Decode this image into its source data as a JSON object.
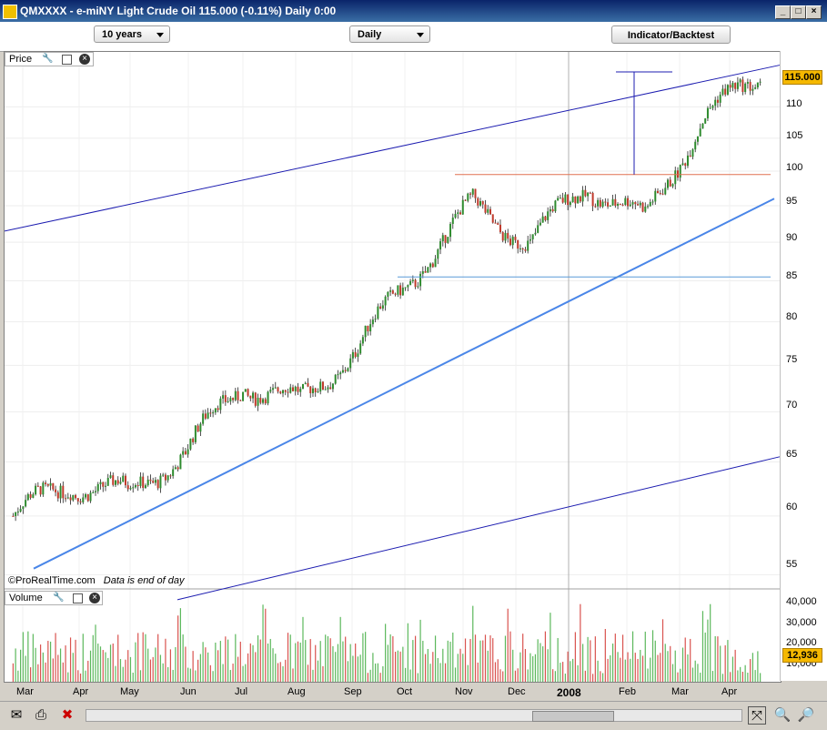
{
  "window": {
    "title": "QMXXXX - e-miNY Light Crude Oil   115.000 (-0.11%)   Daily  0:00",
    "minimize": "_",
    "maximize": "□",
    "close": "×"
  },
  "toolbar": {
    "period": "10 years",
    "interval": "Daily",
    "indicator_button": "Indicator/Backtest"
  },
  "panels": {
    "price_label": "Price",
    "volume_label": "Volume"
  },
  "price_axis": {
    "ticks": [
      "115.000",
      "110",
      "105",
      "100",
      "95",
      "90",
      "85",
      "80",
      "75",
      "70",
      "65",
      "60",
      "55"
    ],
    "current_price": "115.000"
  },
  "volume_axis": {
    "ticks": [
      "40,000",
      "30,000",
      "20,000",
      "10,000"
    ],
    "current_volume": "12,936"
  },
  "time_axis": {
    "labels": [
      "Mar",
      "Apr",
      "May",
      "Jun",
      "Jul",
      "Aug",
      "Sep",
      "Oct",
      "Nov",
      "Dec",
      "2008",
      "Feb",
      "Mar",
      "Apr"
    ]
  },
  "footer": {
    "copyright": "©ProRealTime.com",
    "note": "Data is end of day"
  },
  "chart_data": {
    "type": "candlestick",
    "instrument": "e-miNY Light Crude Oil",
    "y_scale": "log",
    "ylim": [
      54,
      119
    ],
    "monthly_path": [
      {
        "month": "Mar",
        "value": 60
      },
      {
        "month": "Apr",
        "value": 63
      },
      {
        "month": "May",
        "value": 62
      },
      {
        "month": "Jun",
        "value": 66
      },
      {
        "month": "Jul",
        "value": 73
      },
      {
        "month": "Aug",
        "value": 71
      },
      {
        "month": "Sep",
        "value": 77
      },
      {
        "month": "Oct",
        "value": 86
      },
      {
        "month": "Nov",
        "value": 95
      },
      {
        "month": "Dec",
        "value": 90
      },
      {
        "month": "2008",
        "value": 98
      },
      {
        "month": "Feb",
        "value": 93
      },
      {
        "month": "Mar",
        "value": 108
      },
      {
        "month": "Apr",
        "value": 115
      }
    ],
    "lines": [
      {
        "kind": "channel-upper",
        "from_value": 91.5,
        "to_value": 117
      },
      {
        "kind": "channel-lower",
        "from_value": 53,
        "to_value": 65.5
      },
      {
        "kind": "trendline-support",
        "from_value": 55.5,
        "to_value": 96
      },
      {
        "kind": "resistance",
        "value": 99.5
      },
      {
        "kind": "support",
        "value": 85.5
      }
    ],
    "colors": {
      "up": "#2e8b2e",
      "down": "#c0392b",
      "channel": "#1c1cb0",
      "trend": "#4a86e8",
      "resistance": "#e07050",
      "support": "#5a9ad8"
    }
  }
}
